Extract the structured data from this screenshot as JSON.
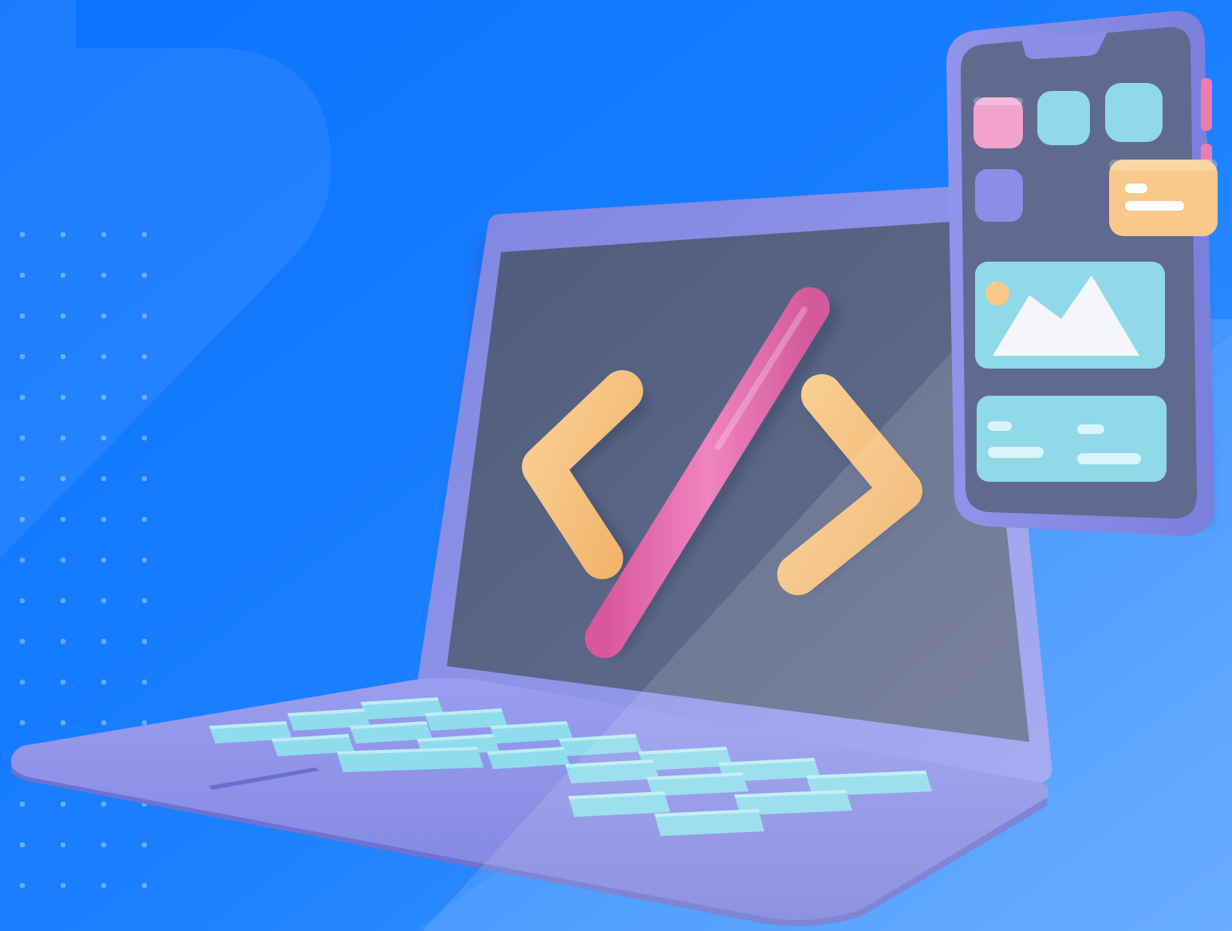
{
  "illustration": {
    "subject": "laptop-with-code-symbol-and-smartphone",
    "icons": {
      "code": "code-brackets-icon",
      "image": "image-mountain-icon",
      "message": "message-card-icon"
    },
    "colors": {
      "background": "#0a77ff",
      "background_light": "#4a9cff",
      "device_body": "#8b8ee6",
      "screen": "#5a6584",
      "key": "#8fdcec",
      "bracket": "#f6c27e",
      "slash": "#e66fb0",
      "app_pink": "#f2a3cc",
      "app_cyan": "#8fd9e8",
      "app_purple": "#8b8ee6",
      "card_orange": "#f8c98a"
    }
  }
}
